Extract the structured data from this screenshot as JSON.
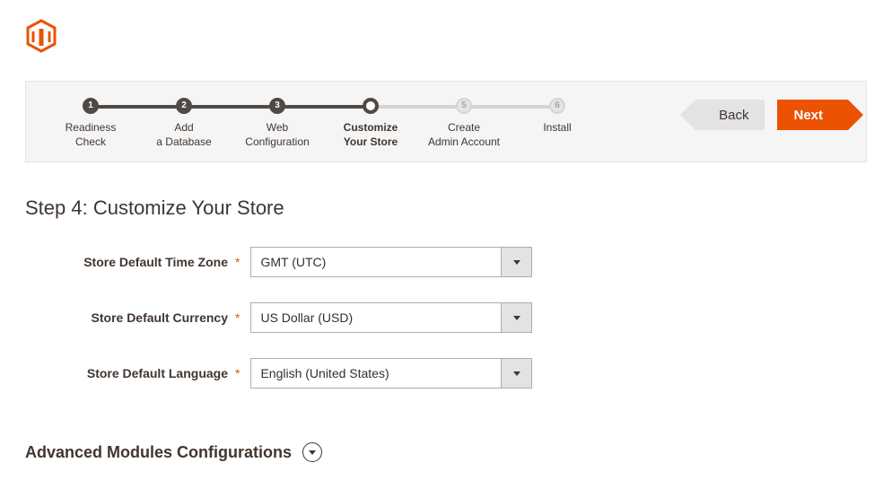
{
  "logo_color": "#eb5202",
  "steps": [
    {
      "num": "1",
      "label_line1": "Readiness",
      "label_line2": "Check",
      "state": "done"
    },
    {
      "num": "2",
      "label_line1": "Add",
      "label_line2": "a Database",
      "state": "done"
    },
    {
      "num": "3",
      "label_line1": "Web",
      "label_line2": "Configuration",
      "state": "done"
    },
    {
      "num": "",
      "label_line1": "Customize",
      "label_line2": "Your Store",
      "state": "current"
    },
    {
      "num": "5",
      "label_line1": "Create",
      "label_line2": "Admin Account",
      "state": "future"
    },
    {
      "num": "6",
      "label_line1": "Install",
      "label_line2": "",
      "state": "future"
    }
  ],
  "nav": {
    "back_label": "Back",
    "next_label": "Next"
  },
  "title": "Step 4: Customize Your Store",
  "form": {
    "timezone": {
      "label": "Store Default Time Zone",
      "value": "GMT (UTC)"
    },
    "currency": {
      "label": "Store Default Currency",
      "value": "US Dollar (USD)"
    },
    "language": {
      "label": "Store Default Language",
      "value": "English (United States)"
    }
  },
  "advanced_label": "Advanced Modules Configurations"
}
